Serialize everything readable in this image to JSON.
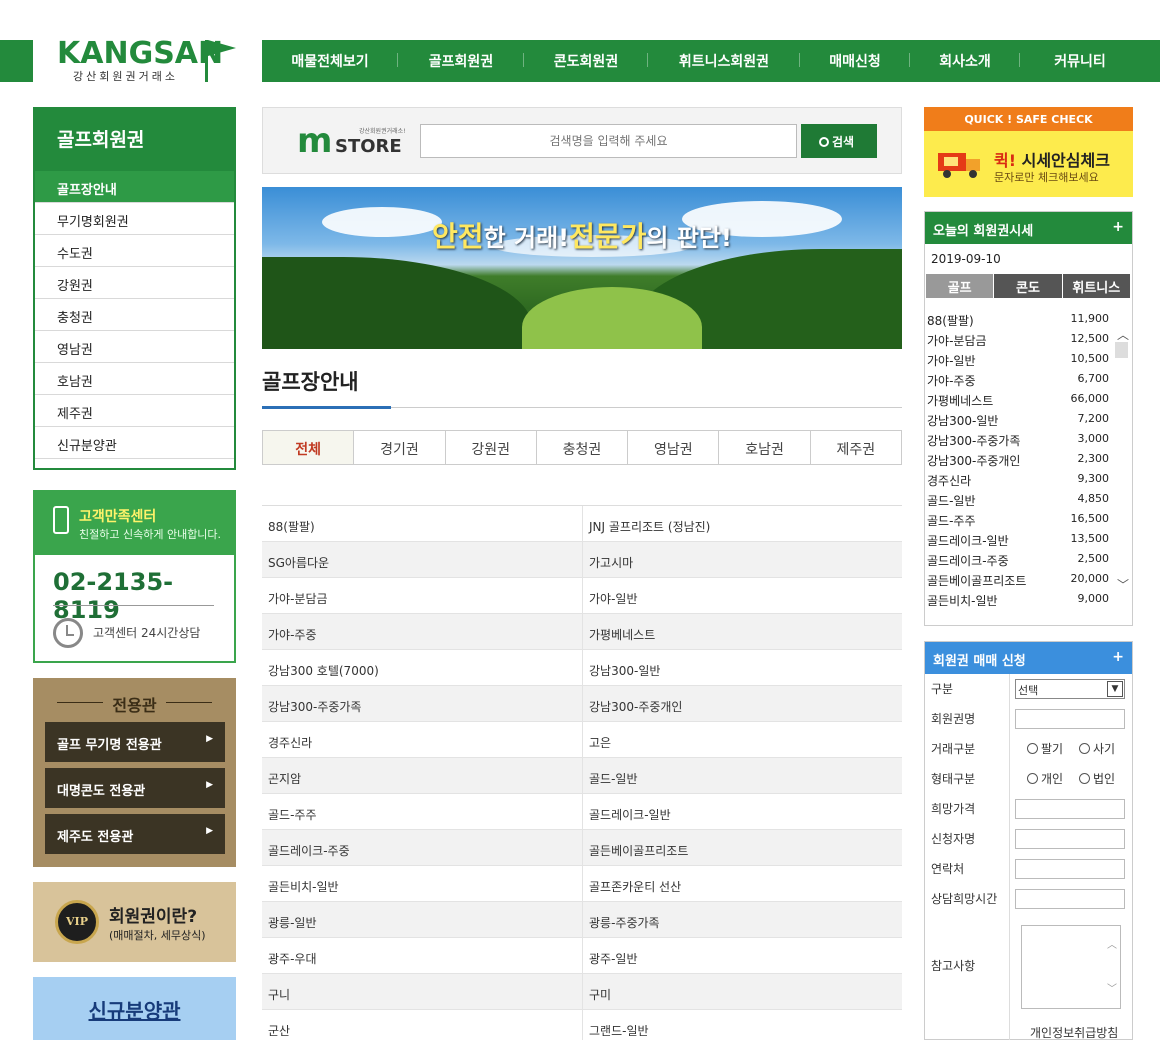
{
  "header": {
    "brand": "KANGSAN",
    "brand_sub": "강산회원권거래소",
    "nav": [
      "매물전체보기",
      "골프회원권",
      "콘도회원권",
      "휘트니스회원권",
      "매매신청",
      "회사소개",
      "커뮤니티"
    ]
  },
  "sidebar": {
    "title": "골프회원권",
    "items": [
      "골프장안내",
      "무기명회원권",
      "수도권",
      "강원권",
      "충청권",
      "영남권",
      "호남권",
      "제주권",
      "신규분양관"
    ]
  },
  "customer_center": {
    "title": "고객만족센터",
    "desc": "친절하고 신속하게 안내합니다.",
    "phone": "02-2135-8119",
    "hours": "고객센터 24시간상담"
  },
  "exclusive": {
    "title": "전용관",
    "buttons": [
      "골프 무기명 전용관",
      "대명콘도 전용관",
      "제주도 전용관"
    ]
  },
  "vip": {
    "badge": "VIP",
    "title": "회원권이란?",
    "desc": "(매매절차, 세무상식)"
  },
  "new_sale": {
    "label": "신규분양관"
  },
  "search": {
    "logo_m": "m",
    "logo_store": "STORE",
    "logo_tiny": "강산회원권거래소!",
    "placeholder": "검색명을 입력해 주세요",
    "button": "검색"
  },
  "hero": {
    "slogan_a": "안전",
    "slogan_b": "한 거래!",
    "slogan_c": "전문가",
    "slogan_d": "의 판단!"
  },
  "section": {
    "title": "골프장안내"
  },
  "region_tabs": [
    "전체",
    "경기권",
    "강원권",
    "충청권",
    "영남권",
    "호남권",
    "제주권"
  ],
  "course_list": [
    [
      "88(팔팔)",
      "JNJ 골프리조트 (정남진)"
    ],
    [
      "SG아름다운",
      "가고시마"
    ],
    [
      "가야-분담금",
      "가야-일반"
    ],
    [
      "가야-주중",
      "가평베네스트"
    ],
    [
      "강남300 호텔(7000)",
      "강남300-일반"
    ],
    [
      "강남300-주중가족",
      "강남300-주중개인"
    ],
    [
      "경주신라",
      "고은"
    ],
    [
      "곤지암",
      "골드-일반"
    ],
    [
      "골드-주주",
      "골드레이크-일반"
    ],
    [
      "골드레이크-주중",
      "골든베이골프리조트"
    ],
    [
      "골든비치-일반",
      "골프존카운티 선산"
    ],
    [
      "광릉-일반",
      "광릉-주중가족"
    ],
    [
      "광주-우대",
      "광주-일반"
    ],
    [
      "구니",
      "구미"
    ],
    [
      "군산",
      "그랜드-일반"
    ]
  ],
  "quick_check": {
    "banner": "QUICK ! SAFE CHECK",
    "title_red": "퀵!",
    "title": "시세안심체크",
    "desc": "문자로만 체크해보세요"
  },
  "today_price": {
    "title": "오늘의 회원권시세",
    "plus": "+",
    "date": "2019-09-10",
    "tabs": [
      "골프",
      "콘도",
      "휘트니스"
    ],
    "rows": [
      {
        "name": "88(팔팔)",
        "value": "11,900"
      },
      {
        "name": "가야-분담금",
        "value": "12,500"
      },
      {
        "name": "가야-일반",
        "value": "10,500"
      },
      {
        "name": "가야-주중",
        "value": "6,700"
      },
      {
        "name": "가평베네스트",
        "value": "66,000"
      },
      {
        "name": "강남300-일반",
        "value": "7,200"
      },
      {
        "name": "강남300-주중가족",
        "value": "3,000"
      },
      {
        "name": "강남300-주중개인",
        "value": "2,300"
      },
      {
        "name": "경주신라",
        "value": "9,300"
      },
      {
        "name": "골드-일반",
        "value": "4,850"
      },
      {
        "name": "골드-주주",
        "value": "16,500"
      },
      {
        "name": "골드레이크-일반",
        "value": "13,500"
      },
      {
        "name": "골드레이크-주중",
        "value": "2,500"
      },
      {
        "name": "골든베이골프리조트",
        "value": "20,000"
      },
      {
        "name": "골든비치-일반",
        "value": "9,000"
      }
    ]
  },
  "apply": {
    "title": "회원권 매매 신청",
    "plus": "+",
    "labels": {
      "category": "구분",
      "name": "회원권명",
      "trade": "거래구분",
      "type": "형태구분",
      "price": "희망가격",
      "applicant": "신청자명",
      "contact": "연락처",
      "time": "상담희망시간",
      "note": "참고사항"
    },
    "select_value": "선택",
    "trade_options": [
      "팔기",
      "사기"
    ],
    "type_options": [
      "개인",
      "법인"
    ],
    "privacy": "개인정보취급방침"
  }
}
